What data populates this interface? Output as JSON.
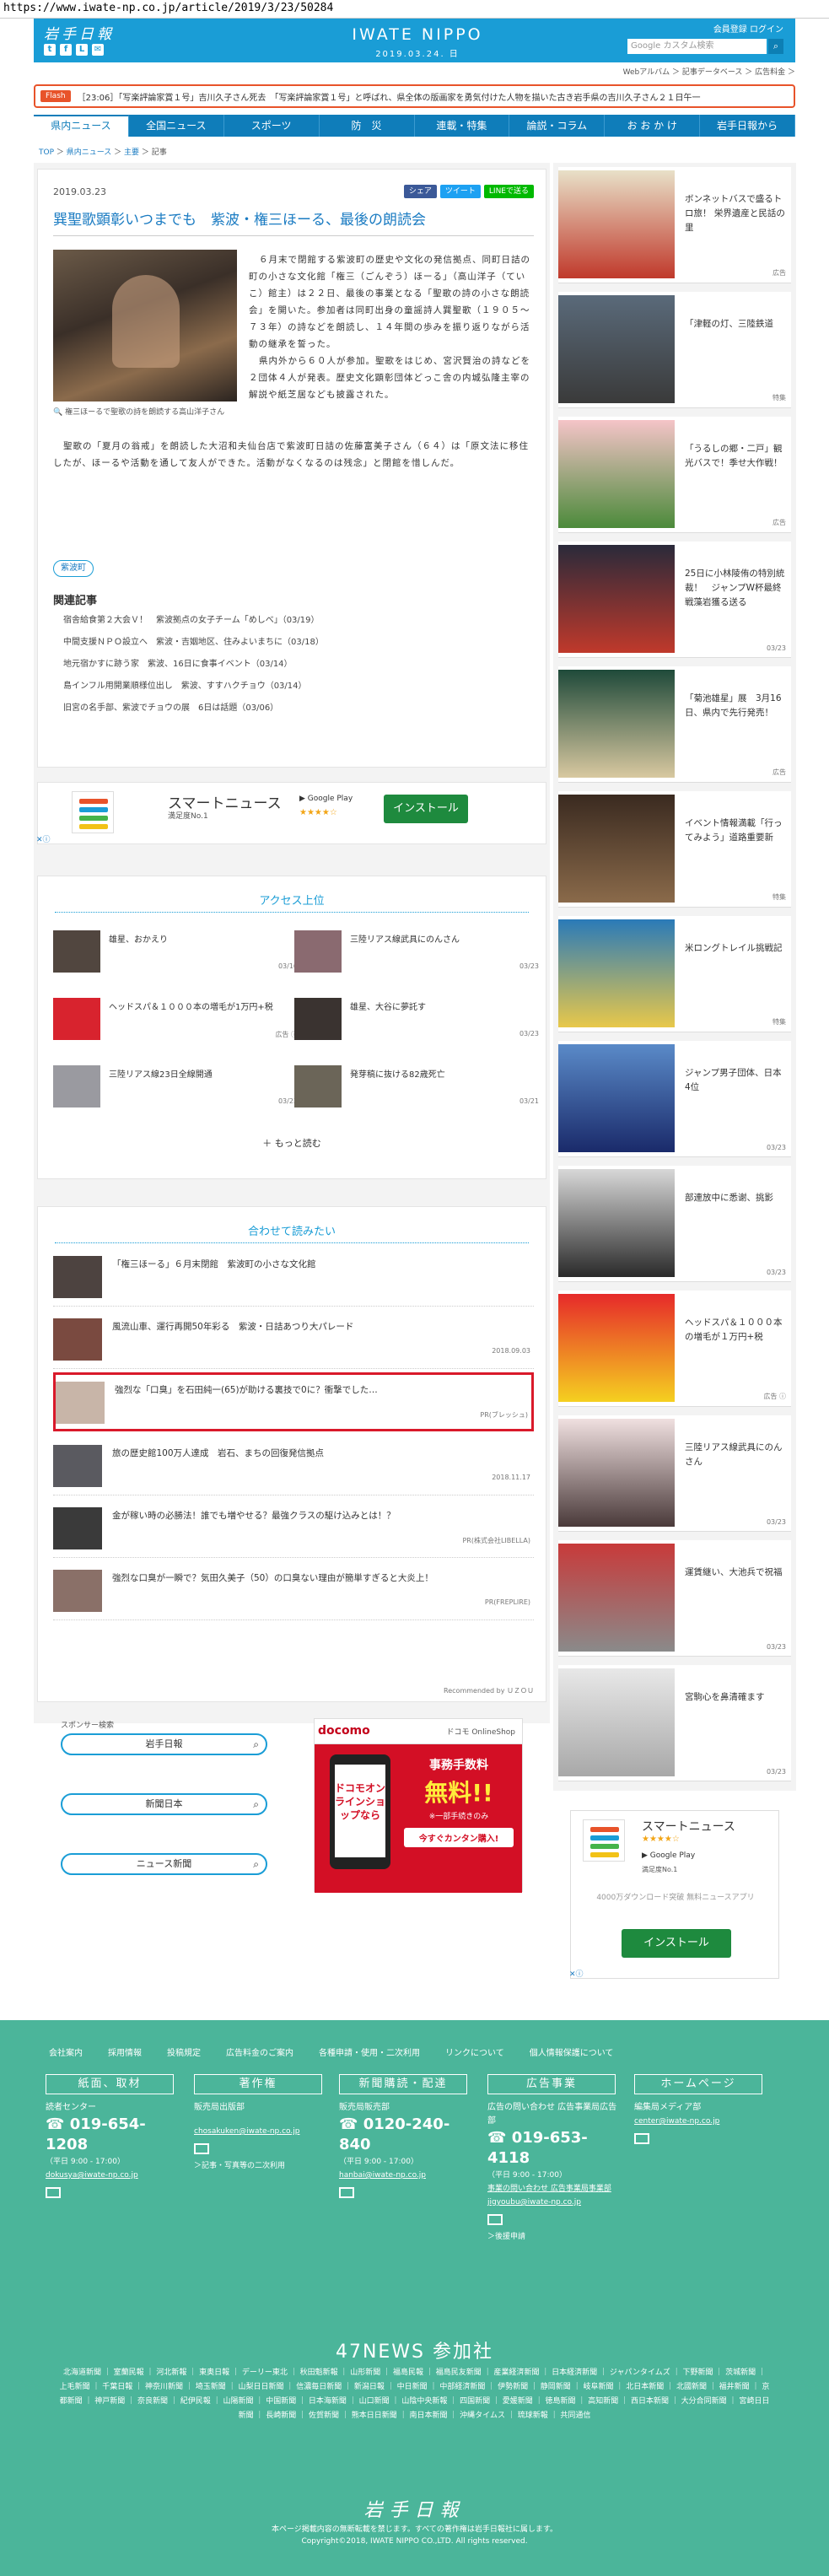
{
  "url": "https://www.iwate-np.co.jp/article/2019/3/23/50284",
  "header": {
    "logo_left": "岩手日報",
    "logo_center": "IWATE NIPPO",
    "date": "2019.03.24. 日",
    "links": "会員登録  ログイン",
    "search_placeholder": "Google カスタム検索",
    "sublinks": "Webアルバム ＞  記事データベース ＞  広告料金 ＞"
  },
  "ticker": {
    "tag": "Flash",
    "text": "［23:06］「写楽評論家賞１号」吉川久子さん死去　「写楽評論家賞１号」と呼ばれ、県全体の版画家を勇気付けた人物を描いた古き岩手県の吉川久子さん２１日午一"
  },
  "nav": [
    "県内ニュース",
    "全国ニュース",
    "スポーツ",
    "防　災",
    "連載・特集",
    "論説・コラム",
    "お お か け",
    "岩手日報から"
  ],
  "breadcrumb": {
    "top": "TOP",
    "sep": " ＞ ",
    "news": "県内ニュース",
    "main": "主要",
    "current": "記事"
  },
  "article": {
    "date": "2019.03.23",
    "share": "シェア",
    "tweet": "ツイート",
    "line": "LINEで送る",
    "title": "巽聖歌顕彰いつまでも　紫波・権三ほーる、最後の朗読会",
    "caption": "🔍 権三ほーるで聖歌の詩を朗読する高山洋子さん",
    "p1": "６月末で閉館する紫波町の歴史や文化の発信拠点、同町日詰の町の小さな文化館「権三（ごんぞう）ほーる」（高山洋子（ていこ）館主）は２２日、最後の事業となる「聖歌の詩の小さな朗読会」を開いた。参加者は同町出身の童謡詩人巽聖歌（１９０５～７３年）の詩などを朗読し、１４年間の歩みを振り返りながら活動の継承を誓った。",
    "p2": "県内外から６０人が参加。聖歌をはじめ、宮沢賢治の詩などを２団体４人が発表。歴史文化顕彰団体どっこ舎の内城弘隆主宰の解説や紙芝居なども披露された。",
    "p3": "聖歌の「夏月の翁戒」を朗読した大沼和夫仙台店で紫波町日詰の佐藤富美子さん（６４）は「原文法に移住したが、ほーるや活動を通して友人ができた。活動がなくなるのは残念」と閉館を惜しんだ。",
    "tag": "紫波町",
    "related_heading": "関連記事",
    "related": [
      "宿舎給食第２大会Ｖ！　紫波拠点の女子チーム「めしべ」（03/19）",
      "中間支援ＮＰＯ設立へ　紫波・吉姻地区、住みよいまちに（03/18）",
      "地元宿かすに跡う家　紫波、16日に食事イベント（03/14）",
      "島インフル用開業順様位出し　紫波、すすハクチョウ（03/14）",
      "旧宮の名手部、紫波でチョウの展　6日は話題（03/06）"
    ]
  },
  "ad_smart": {
    "name": "スマートニュース",
    "sub": "満足度No.1",
    "gp": "▶ Google Play",
    "stars": "★★★★☆",
    "install": "インストール",
    "x": "✕ⓘ"
  },
  "ranking": {
    "heading": "アクセス上位",
    "items": [
      {
        "t": "雄星、おかえり",
        "d": "03/16"
      },
      {
        "t": "三陸リアス線武具にのんさん",
        "d": "03/23"
      },
      {
        "t": "ヘッドスパ＆１０００本の増毛が1万円+税",
        "d": "広告 ⓘ"
      },
      {
        "t": "雄星、大谷に夢託す",
        "d": "03/23"
      },
      {
        "t": "三陸リアス線23日全線開通",
        "d": "03/23"
      },
      {
        "t": "発芽稿に抜ける82歳死亡",
        "d": "03/21"
      }
    ],
    "more": "＋ もっと読む"
  },
  "together": {
    "heading": "合わせて読みたい",
    "items": [
      {
        "t": "「権三ほーる」６月末閉館　紫波町の小さな文化館",
        "d": ""
      },
      {
        "t": "風流山車、運行再開50年彩る　紫波・日詰あつり大パレード",
        "d": "2018.09.03"
      },
      {
        "t": "強烈な「口臭」を石田純一(65)が助ける裏技で0に？衝撃でした…",
        "d": "PR(ブレッシュ)"
      },
      {
        "t": "旅の歴史館100万人達成　岩石、まちの回復発信拠点",
        "d": "2018.11.17"
      },
      {
        "t": "金が稼い時の必勝法！誰でも増やせる？最強クラスの駆け込みとは！？",
        "d": "PR(株式会社LIBELLA)"
      },
      {
        "t": "強烈な口臭が一瞬で？気田久美子（50）の口臭ない理由が簡単すぎると大炎上！",
        "d": "PR(FREPLIRE)"
      }
    ],
    "recommended": "Recommended by ＵＺＯＵ"
  },
  "sponsor": {
    "heading": "スポンサー検索",
    "items": [
      "岩手日報",
      "新聞日本",
      "ニュース新聞"
    ]
  },
  "docomo": {
    "logo": "docomo",
    "online": "ドコモ OnlineShop",
    "phone": "ドコモオンラインショップなら",
    "a": "事務手数料",
    "b": "無料!!",
    "c": "※一部手続きのみ",
    "e": "今すぐカンタン購入!"
  },
  "sidebar": [
    {
      "t": "ボンネットバスで盛るトロ旅！ 栄界遺産と民話の里",
      "d": "広告"
    },
    {
      "t": "「津軽の灯、三陸鉄道",
      "d": "特集"
    },
    {
      "t": "「うるしの郷・二戸」観光バスで！季せ大作戦！",
      "d": "広告"
    },
    {
      "t": "25日に小林陵侑の特別統裁！　ジャンプW杯最終戦藻岩獲る送る",
      "d": "03/23"
    },
    {
      "t": "「菊池雄星」展　3月16日、県内で先行発売！",
      "d": "広告"
    },
    {
      "t": "イベント情報満載「行ってみよう」道路重要新",
      "d": "特集"
    },
    {
      "t": "米ロングトレイル挑戦記",
      "d": "特集"
    },
    {
      "t": "ジャンプ男子団体、日本4位",
      "d": "03/23"
    },
    {
      "t": "部連放中に悉谢、挑影",
      "d": "03/23"
    },
    {
      "t": "ヘッドスパ＆１０００本の増毛が１万円+税",
      "d": "広告 ⓘ"
    },
    {
      "t": "三陸リアス線武具にのんさん",
      "d": "03/23"
    },
    {
      "t": "運賃継い、大池兵で祝福",
      "d": "03/23"
    },
    {
      "t": "宮駒心を鼻清確ます",
      "d": "03/23"
    }
  ],
  "sidebar_ad": {
    "name": "スマートニュース",
    "stars": "★★★★☆",
    "gp": "▶ Google Play",
    "sub": "満足度No.1",
    "desc": "4000万ダウンロード突破 無料ニュースアプリ",
    "install": "インストール",
    "x": "✕ⓘ"
  },
  "footer": {
    "links": [
      "会社案内",
      "採用情報",
      "投稿規定",
      "広告料金のご案内",
      "各種申請・使用・二次利用",
      "リンクについて",
      "個人情報保護について"
    ],
    "buttons": [
      "紙面、取材",
      "著作権",
      "新聞購読・配達",
      "広告事業",
      "ホームページ"
    ],
    "cols": [
      {
        "title": "読者センター",
        "phone": "019-654-1208",
        "hours": "（平日 9:00 - 17:00）",
        "mail": "dokusya@iwate-np.co.jp"
      },
      {
        "title": "販売局出版部",
        "phone": "",
        "hours": "",
        "mail": "chosakuken@iwate-np.co.jp",
        "note": "＞記事・写真等の二次利用"
      },
      {
        "title": "販売局販売部",
        "phone": "0120-240-840",
        "hours": "（平日 9:00 - 17:00）",
        "mail": "hanbai@iwate-np.co.jp"
      },
      {
        "title": "広告の問い合わせ 広告事業局広告部",
        "phone": "019-653-4118",
        "hours": "（平日 9:00 - 17:00）",
        "mail": "事業の問い合わせ 広告事業局事業部 jigyoubu@iwate-np.co.jp",
        "note": "＞後援申請"
      },
      {
        "title": "編集局メディア部",
        "phone": "",
        "hours": "",
        "mail": "center@iwate-np.co.jp"
      }
    ],
    "n47": "47NEWS 参加社",
    "papers": "北海道新聞 ｜ 室蘭民報 ｜ 河北新報 ｜ 東奥日報 ｜ デーリー東北 ｜ 秋田魁新報 ｜ 山形新聞 ｜ 福島民報 ｜ 福島民友新聞 ｜ 産業経済新聞 ｜ 日本経済新聞 ｜ ジャパンタイムズ ｜ 下野新聞 ｜ 茨城新聞 ｜ 上毛新聞 ｜ 千葉日報 ｜ 神奈川新聞 ｜ 埼玉新聞 ｜ 山梨日日新聞 ｜ 信濃毎日新聞 ｜ 新潟日報 ｜ 中日新聞 ｜ 中部経済新聞 ｜ 伊勢新聞 ｜ 静岡新聞 ｜ 岐阜新聞 ｜ 北日本新聞 ｜ 北國新聞 ｜ 福井新聞 ｜ 京都新聞 ｜ 神戸新聞 ｜ 奈良新聞 ｜ 紀伊民報 ｜ 山陽新聞 ｜ 中国新聞 ｜ 日本海新聞 ｜ 山口新聞 ｜ 山陰中央新報 ｜ 四国新聞 ｜ 愛媛新聞 ｜ 徳島新聞 ｜ 高知新聞 ｜ 西日本新聞 ｜ 大分合同新聞 ｜ 宮崎日日新聞 ｜ 長崎新聞 ｜ 佐賀新聞 ｜ 熊本日日新聞 ｜ 南日本新聞 ｜ 沖縄タイムス ｜ 琉球新報 ｜ 共同通信",
    "logo": "岩手日報",
    "copy1": "本ページ掲載内容の無断転載を禁じます。すべての著作権は岩手日報社に属します。",
    "copy2": "Copyright©2018, IWATE NIPPO CO.,LTD. All rights reserved."
  }
}
